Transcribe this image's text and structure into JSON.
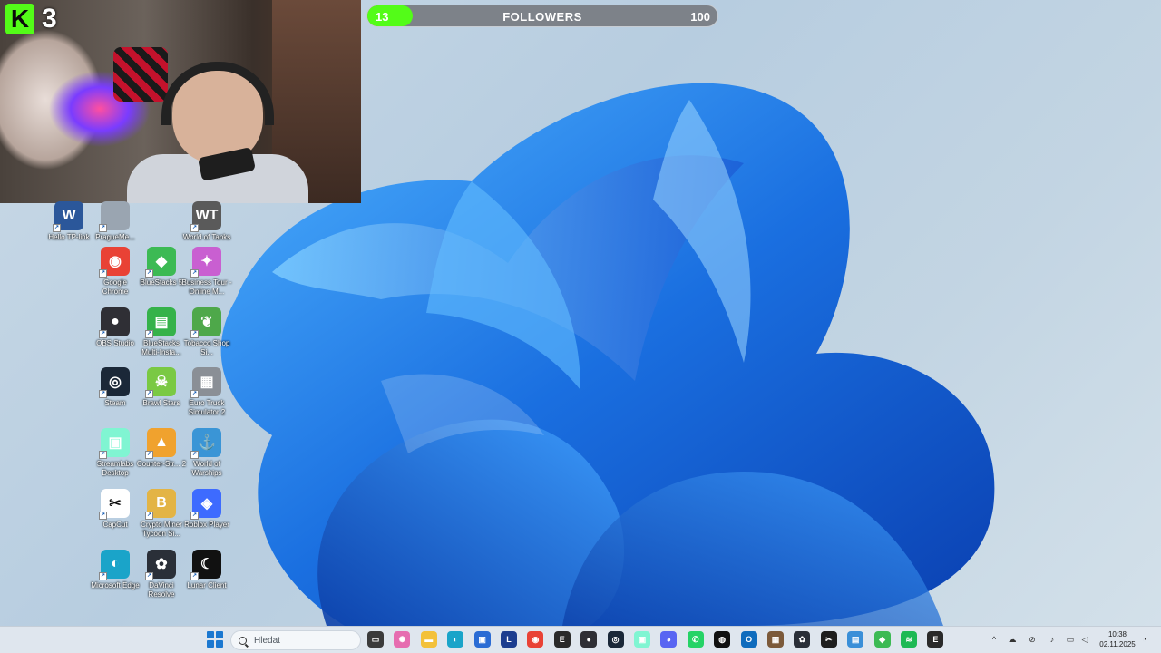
{
  "overlay": {
    "viewer_count": "3",
    "logo_letter": "K",
    "followers": {
      "title": "FOLLOWERS",
      "current": "13",
      "goal": "100",
      "progress": 0.13
    }
  },
  "desktop_icons": [
    {
      "label": "Hello TP-link",
      "icon": "word-icon",
      "color": "#2b579a",
      "glyph": "W"
    },
    {
      "label": "PragueMe...",
      "icon": "file-icon",
      "color": "#9aa5b1",
      "glyph": ""
    },
    {
      "label": "World of Tanks",
      "icon": "world-of-tanks-icon",
      "color": "#5a5a5a",
      "glyph": "WT"
    },
    {
      "label": "Google Chrome",
      "icon": "chrome-icon",
      "color": "#e94235",
      "glyph": "◉"
    },
    {
      "label": "BlueStacks 5",
      "icon": "bluestacks-icon",
      "color": "#3cba54",
      "glyph": "◆"
    },
    {
      "label": "Business Tour - Online M...",
      "icon": "business-tour-icon",
      "color": "#c95fd1",
      "glyph": "✦"
    },
    {
      "label": "OBS Studio",
      "icon": "obs-icon",
      "color": "#2f2f35",
      "glyph": "●"
    },
    {
      "label": "BlueStacks Multi-Insta...",
      "icon": "bluestacks-multi-icon",
      "color": "#35b24a",
      "glyph": "▤"
    },
    {
      "label": "Tobacco Shop Si...",
      "icon": "tobacco-shop-icon",
      "color": "#4ea84a",
      "glyph": "❦"
    },
    {
      "label": "Steam",
      "icon": "steam-icon",
      "color": "#1b2838",
      "glyph": "◎"
    },
    {
      "label": "Brawl Stars",
      "icon": "brawl-stars-icon",
      "color": "#7ac943",
      "glyph": "☠"
    },
    {
      "label": "Euro Truck Simulator 2",
      "icon": "euro-truck-icon",
      "color": "#8a8f96",
      "glyph": "▦"
    },
    {
      "label": "Streamlabs Desktop",
      "icon": "streamlabs-icon",
      "color": "#80f5d2",
      "glyph": "▣"
    },
    {
      "label": "Counter-Str... 2",
      "icon": "counter-strike-icon",
      "color": "#f0a22e",
      "glyph": "▲"
    },
    {
      "label": "World of Warships",
      "icon": "world-of-warships-icon",
      "color": "#3a95d6",
      "glyph": "⚓"
    },
    {
      "label": "CapCut",
      "icon": "capcut-icon",
      "color": "#ffffff",
      "glyph": "✂"
    },
    {
      "label": "Crypto Miner Tycoon Si...",
      "icon": "crypto-miner-icon",
      "color": "#e3b445",
      "glyph": "B"
    },
    {
      "label": "Roblox Player",
      "icon": "roblox-icon",
      "color": "#3d6bff",
      "glyph": "◈"
    },
    {
      "label": "Microsoft Edge",
      "icon": "edge-icon",
      "color": "#1aa4c9",
      "glyph": "◐"
    },
    {
      "label": "DaVinci Resolve",
      "icon": "davinci-icon",
      "color": "#2a2f38",
      "glyph": "✿"
    },
    {
      "label": "Lunar Client",
      "icon": "lunar-client-icon",
      "color": "#111111",
      "glyph": "☾"
    }
  ],
  "taskbar": {
    "search_placeholder": "Hledat",
    "apps": [
      {
        "name": "task-view-icon",
        "color": "#3b3b3b",
        "glyph": "▭"
      },
      {
        "name": "copilot-icon",
        "color": "#e66cb0",
        "glyph": "✺"
      },
      {
        "name": "file-explorer-icon",
        "color": "#f3c13a",
        "glyph": "▬"
      },
      {
        "name": "edge-icon",
        "color": "#1aa4c9",
        "glyph": "◐"
      },
      {
        "name": "store-icon",
        "color": "#2b6cd4",
        "glyph": "▣"
      },
      {
        "name": "lunar-launcher-icon",
        "color": "#1c3d8f",
        "glyph": "L"
      },
      {
        "name": "chrome-icon",
        "color": "#e94235",
        "glyph": "◉"
      },
      {
        "name": "epic-games-icon",
        "color": "#2a2a2a",
        "glyph": "E"
      },
      {
        "name": "obs-icon",
        "color": "#2f2f35",
        "glyph": "●"
      },
      {
        "name": "steam-icon",
        "color": "#1b2838",
        "glyph": "◎"
      },
      {
        "name": "streamlabs-icon",
        "color": "#80f5d2",
        "glyph": "▣"
      },
      {
        "name": "discord-icon",
        "color": "#5865f2",
        "glyph": "◕"
      },
      {
        "name": "whatsapp-icon",
        "color": "#25d366",
        "glyph": "✆"
      },
      {
        "name": "github-icon",
        "color": "#111111",
        "glyph": "◍"
      },
      {
        "name": "outlook-icon",
        "color": "#0f6cbd",
        "glyph": "O"
      },
      {
        "name": "minecraft-icon",
        "color": "#7c5a3a",
        "glyph": "▦"
      },
      {
        "name": "davinci-icon",
        "color": "#2a2f38",
        "glyph": "✿"
      },
      {
        "name": "capcut-icon",
        "color": "#1e1e1e",
        "glyph": "✂"
      },
      {
        "name": "notepad-icon",
        "color": "#3a8fd8",
        "glyph": "▤"
      },
      {
        "name": "bluestacks-icon",
        "color": "#3cba54",
        "glyph": "◆"
      },
      {
        "name": "spotify-icon",
        "color": "#1db954",
        "glyph": "≋"
      },
      {
        "name": "epic-games-2-icon",
        "color": "#2a2a2a",
        "glyph": "E"
      }
    ],
    "time": "10:38",
    "date": "02.11.2025"
  }
}
